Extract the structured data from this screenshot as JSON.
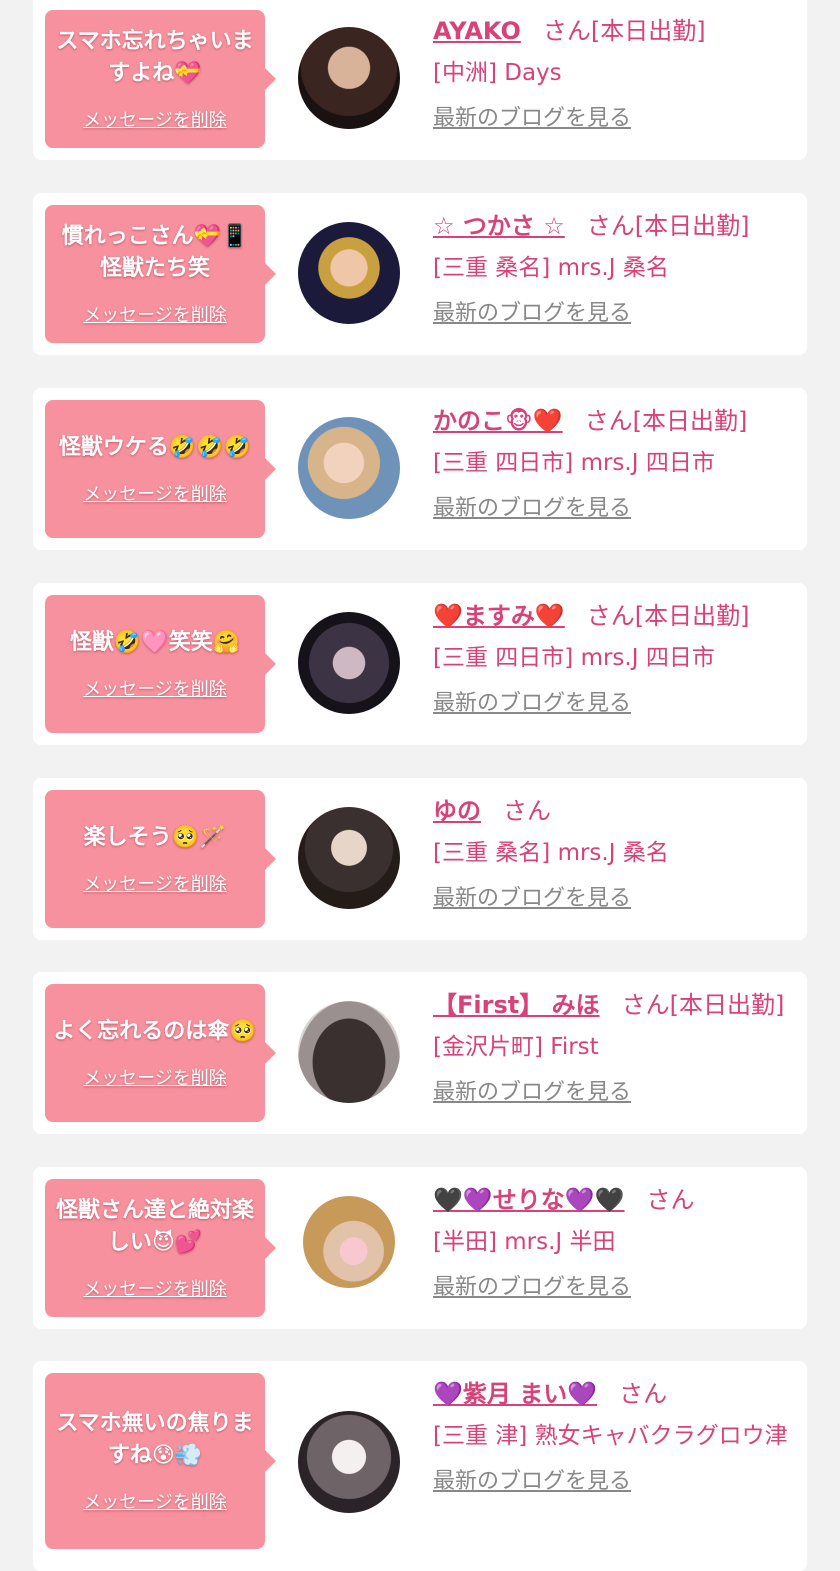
{
  "entries": [
    {
      "message": "スマホ忘れちゃいますよね💝",
      "delete_label": "メッセージを削除",
      "name": "AYAKO",
      "suffix": "さん[本日出勤]",
      "shop": "[中洲] Days",
      "blog_label": "最新のブログを見る",
      "avatar_icon": "avatar-photo"
    },
    {
      "message": "慣れっこさん💝📱怪獣たち笑",
      "delete_label": "メッセージを削除",
      "name": "☆ つかさ ☆",
      "suffix": "さん[本日出勤]",
      "shop": "[三重 桑名] mrs.J 桑名",
      "blog_label": "最新のブログを見る",
      "avatar_icon": "avatar-photo"
    },
    {
      "message": "怪獣ウケる🤣🤣🤣",
      "delete_label": "メッセージを削除",
      "name": "かのこ🐵❤️",
      "suffix": "さん[本日出勤]",
      "shop": "[三重 四日市] mrs.J 四日市",
      "blog_label": "最新のブログを見る",
      "avatar_icon": "avatar-photo"
    },
    {
      "message": "怪獣🤣🩷笑笑🤗",
      "delete_label": "メッセージを削除",
      "name": "❤️ますみ❤️",
      "suffix": "さん[本日出勤]",
      "shop": "[三重 四日市] mrs.J 四日市",
      "blog_label": "最新のブログを見る",
      "avatar_icon": "avatar-photo"
    },
    {
      "message": "楽しそう🥺🪄",
      "delete_label": "メッセージを削除",
      "name": "ゆの",
      "suffix": "さん",
      "shop": "[三重 桑名] mrs.J 桑名",
      "blog_label": "最新のブログを見る",
      "avatar_icon": "avatar-photo"
    },
    {
      "message": "よく忘れるのは傘🥺",
      "delete_label": "メッセージを削除",
      "name": "【First】 みほ",
      "suffix": "さん[本日出勤]",
      "shop": "[金沢片町] First",
      "blog_label": "最新のブログを見る",
      "avatar_icon": "avatar-photo"
    },
    {
      "message": "怪獣さん達と絶対楽しい😈💕",
      "delete_label": "メッセージを削除",
      "name": "🖤💜せりな💜🖤",
      "suffix": "さん",
      "shop": "[半田] mrs.J 半田",
      "blog_label": "最新のブログを見る",
      "avatar_icon": "avatar-photo"
    },
    {
      "message": "スマホ無いの焦りますね😰💨",
      "delete_label": "メッセージを削除",
      "name": "💜紫月 まい💜",
      "suffix": "さん",
      "shop": "[三重 津] 熟女キャバクラグロウ津",
      "blog_label": "最新のブログを見る",
      "avatar_icon": "avatar-photo"
    }
  ],
  "colors": {
    "accent": "#d7427a",
    "bubble": "#f7919d",
    "link_gray": "#888888",
    "background": "#f2f2f2"
  }
}
